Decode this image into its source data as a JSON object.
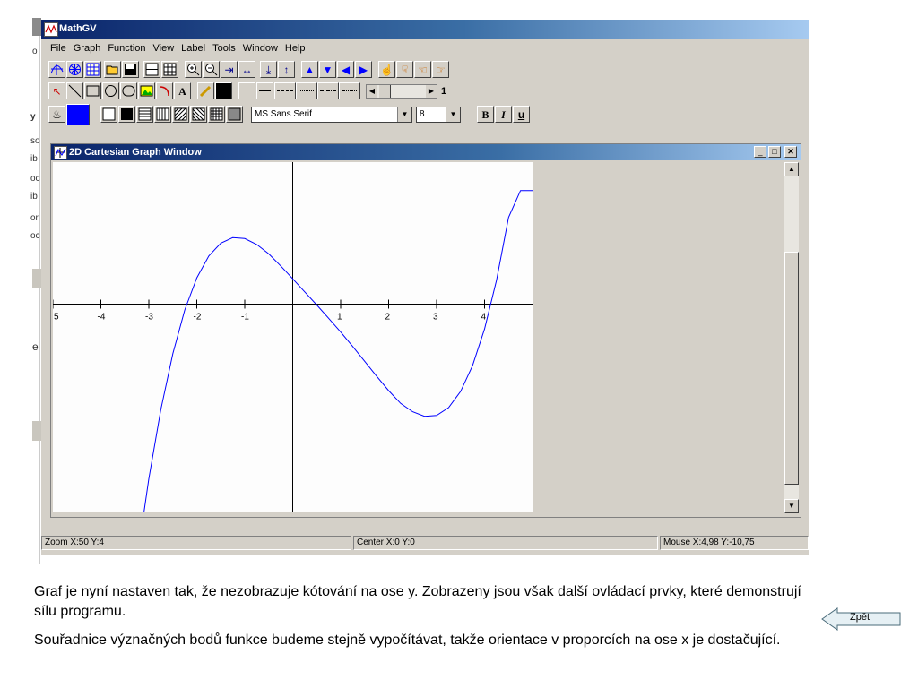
{
  "app": {
    "title": "MathGV",
    "menu": [
      "File",
      "Graph",
      "Function",
      "View",
      "Label",
      "Tools",
      "Window",
      "Help"
    ]
  },
  "toolbar3": {
    "font": "MS Sans Serif",
    "size": "8",
    "bold": "B",
    "italic": "I",
    "underline": "u",
    "line_width": "1"
  },
  "child": {
    "title": "2D Cartesian Graph Window"
  },
  "status": {
    "zoom": "Zoom X:50 Y:4",
    "center": "Center X:0 Y:0",
    "mouse": "Mouse X:4,98 Y:-10,75"
  },
  "chart_data": {
    "type": "line",
    "x_ticks": [
      "5",
      "-4",
      "-3",
      "-2",
      "-1",
      "1",
      "2",
      "3",
      "4"
    ],
    "xlim": [
      -5,
      5
    ],
    "ylim": [
      -9.5,
      6.5
    ],
    "series": [
      {
        "x": [
          -3.1,
          -3.0,
          -2.75,
          -2.5,
          -2.25,
          -2.0,
          -1.75,
          -1.5,
          -1.25,
          -1.0,
          -0.75,
          -0.5,
          -0.25,
          0.0,
          0.25,
          0.5,
          0.75,
          1.0,
          1.25,
          1.5,
          1.75,
          2.0,
          2.25,
          2.5,
          2.75,
          3.0,
          3.25,
          3.5,
          3.75,
          4.0,
          4.25,
          4.5,
          4.75,
          5.0
        ],
        "y": [
          -9.5,
          -8.0,
          -4.83,
          -2.27,
          -0.27,
          1.2,
          2.2,
          2.79,
          3.04,
          3.0,
          2.73,
          2.3,
          1.75,
          1.16,
          0.56,
          -0.04,
          -0.65,
          -1.28,
          -1.94,
          -2.62,
          -3.3,
          -3.96,
          -4.55,
          -4.93,
          -5.14,
          -5.1,
          -4.74,
          -4.0,
          -2.82,
          -1.14,
          1.1,
          3.97,
          5.2,
          5.2
        ],
        "color": "#0000ff"
      }
    ]
  },
  "caption": {
    "p1": "Graf je nyní nastaven tak, že nezobrazuje kótování na ose y. Zobrazeny jsou však další ovládací prvky, které demonstrují sílu programu.",
    "p2": "Souřadnice význačných bodů funkce budeme stejně vypočítávat, takže orientace v proporcích na ose x je dostačující."
  },
  "back_button": {
    "label": "Zpět"
  },
  "bg_fragments": [
    "o",
    "y",
    "so",
    "ib",
    "oc",
    "ib",
    "or",
    "oc",
    "e"
  ]
}
